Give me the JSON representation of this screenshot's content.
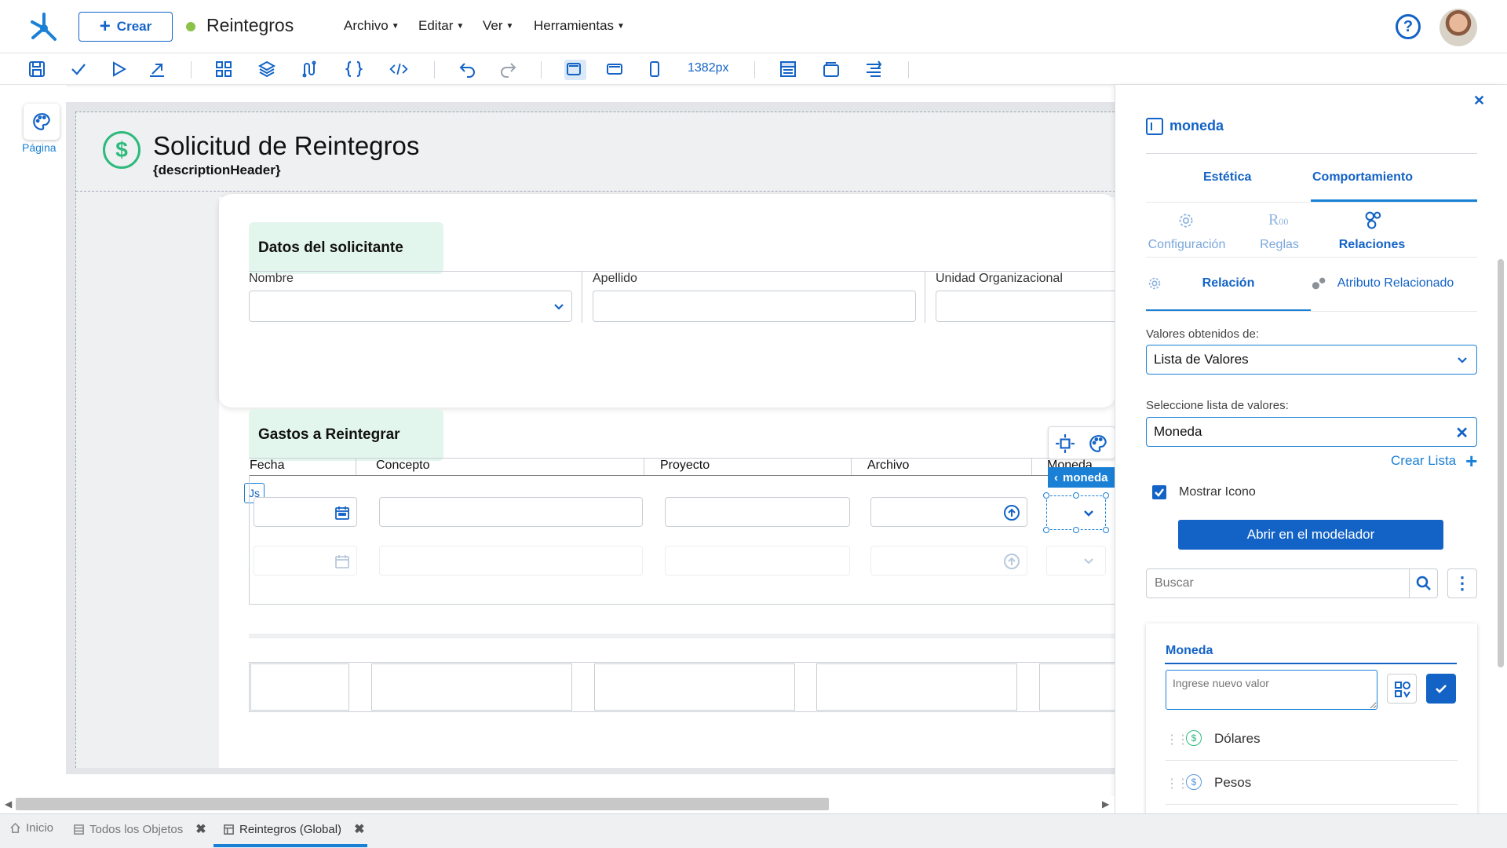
{
  "topbar": {
    "crear_label": "Crear",
    "app_title": "Reintegros",
    "menus": [
      "Archivo",
      "Editar",
      "Ver",
      "Herramientas"
    ],
    "help_label": "?"
  },
  "toolbar": {
    "width_value": "1382px",
    "icons": [
      "save-icon",
      "check-icon",
      "play-icon",
      "export-icon",
      "components-icon",
      "layers-icon",
      "flow-icon",
      "braces-icon",
      "code-icon",
      "undo-icon",
      "redo-icon",
      "desktop-icon",
      "tablet-icon",
      "mobile-icon",
      "header-view-icon",
      "window-icon",
      "align-icon"
    ]
  },
  "rail": {
    "pagina_label": "Página"
  },
  "form": {
    "title": "Solicitud de Reintegros",
    "description": "{descriptionHeader}",
    "section1": {
      "title": "Datos del solicitante",
      "fields": [
        "Nombre",
        "Apellido",
        "Unidad Organizacional"
      ]
    },
    "section2": {
      "title": "Gastos a Reintegrar",
      "columns": [
        "Fecha",
        "Concepto",
        "Proyecto",
        "Archivo",
        "Moneda"
      ],
      "js_badge": "Js",
      "selected_chip": "moneda"
    }
  },
  "panel": {
    "element_name": "moneda",
    "tabs": [
      "Estética",
      "Comportamiento"
    ],
    "subtabs": [
      "Configuración",
      "Reglas",
      "Relaciones"
    ],
    "rel_tabs": [
      "Relación",
      "Atributo Relacionado"
    ],
    "valores_label": "Valores obtenidos de:",
    "valores_value": "Lista de Valores",
    "seleccione_label": "Seleccione lista de valores:",
    "seleccione_value": "Moneda",
    "crear_lista": "Crear Lista",
    "mostrar_icono": "Mostrar Icono",
    "abrir_modelador": "Abrir en el modelador",
    "buscar_placeholder": "Buscar",
    "list_title": "Moneda",
    "nuevo_valor_placeholder": "Ingrese nuevo valor",
    "items": [
      "Dólares",
      "Pesos"
    ]
  },
  "bottom_tabs": [
    "Inicio",
    "Todos los Objetos",
    "Reintegros (Global)"
  ],
  "colors": {
    "primary": "#1363c6",
    "accent_green": "#2dba7c",
    "section_bg": "#e3f6ee"
  }
}
